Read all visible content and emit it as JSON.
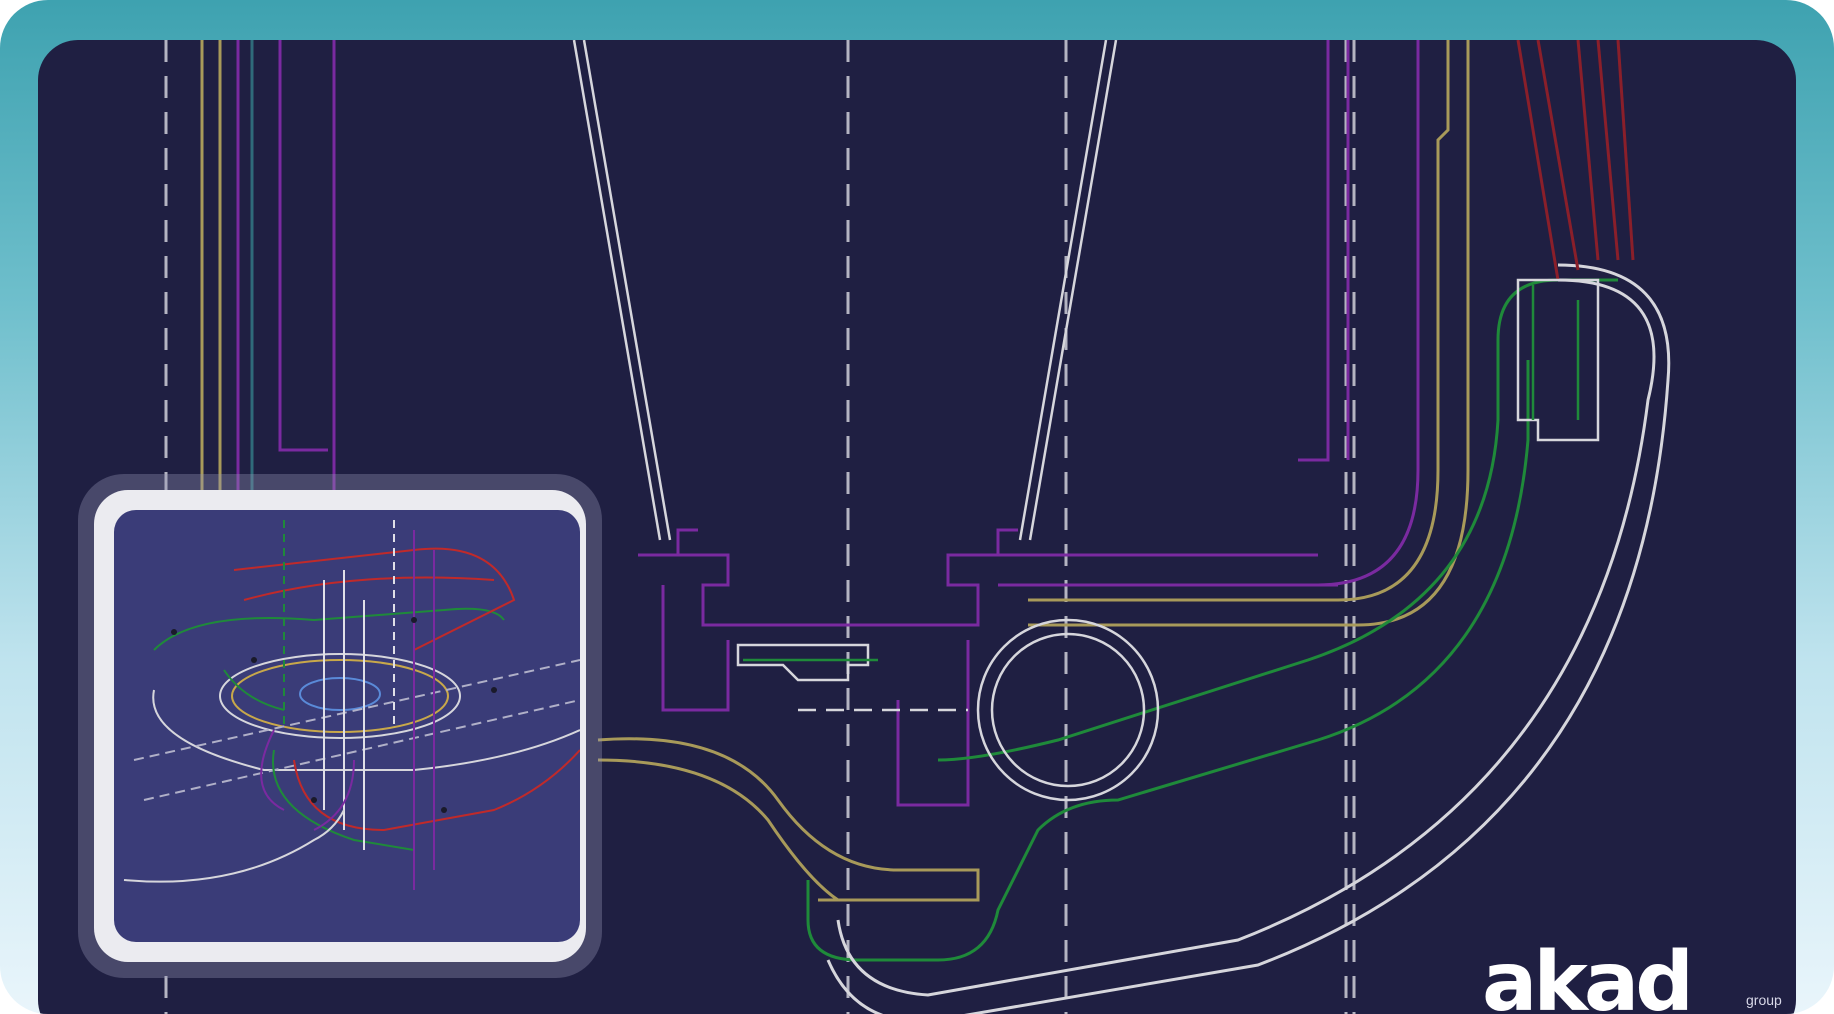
{
  "brand": {
    "name": "akad",
    "sub": "group"
  },
  "colors": {
    "frame_gradient_top": "#3ea2b0",
    "frame_gradient_bottom": "#e9f5fb",
    "panel_bg": "#1f1f42",
    "inset_bg": "#3a3c78",
    "line_white": "#d6d6dc",
    "line_purple": "#7a2aa0",
    "line_green": "#1f8a3a",
    "line_yellow": "#a89a5a",
    "line_red": "#8a1f2a"
  },
  "icons": {
    "cad_drawing": "technical-piping-drawing",
    "model_3d": "isometric-3d-piping-model"
  }
}
